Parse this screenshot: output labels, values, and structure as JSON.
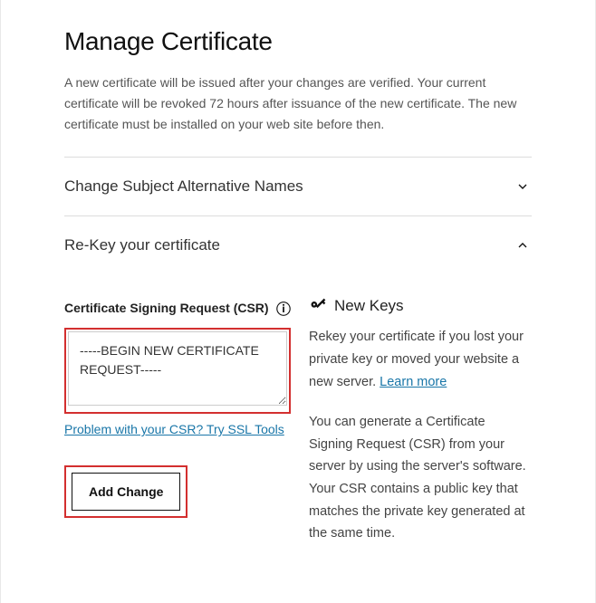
{
  "page": {
    "title": "Manage Certificate",
    "description": "A new certificate will be issued after your changes are verified. Your current certificate will be revoked 72 hours after issuance of the new certificate. The new certificate must be installed on your web site before then."
  },
  "accordion": {
    "san": {
      "title": "Change Subject Alternative Names"
    },
    "rekey": {
      "title": "Re-Key your certificate"
    }
  },
  "csr": {
    "label": "Certificate Signing Request (CSR)",
    "value": "-----BEGIN NEW CERTIFICATE REQUEST-----",
    "help_link": "Problem with your CSR? Try SSL Tools",
    "add_change_label": "Add Change"
  },
  "new_keys": {
    "title": "New Keys",
    "paragraph1_prefix": "Rekey your certificate if you lost your private key or moved your website a new server. ",
    "learn_more": "Learn more",
    "paragraph2": "You can generate a Certificate Signing Request (CSR) from your server by using the server's software. Your CSR contains a public key that matches the private key generated at the same time."
  }
}
